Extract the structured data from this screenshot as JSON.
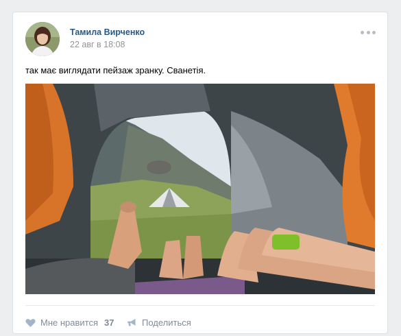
{
  "post": {
    "author": "Тамила Вирченко",
    "date": "22 авг в 18:08",
    "text": "так має виглядати пейзаж зранку. Сванетія."
  },
  "actions": {
    "like_label": "Мне нравится",
    "like_count": "37",
    "share_label": "Поделиться"
  },
  "icons": {
    "like": "heart-icon",
    "share": "megaphone-icon",
    "menu": "more-dots-icon"
  },
  "colors": {
    "link": "#2a5885",
    "muted": "#828a99",
    "page_bg": "#edeef0"
  }
}
